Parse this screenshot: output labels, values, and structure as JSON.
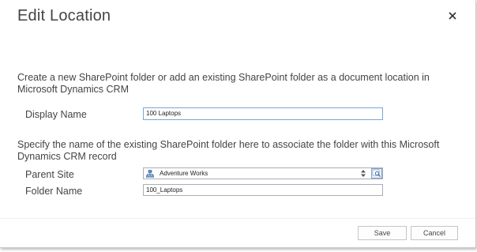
{
  "dialog": {
    "title": "Edit Location"
  },
  "section1": {
    "description": "Create a new SharePoint folder or add an existing SharePoint folder as a document location in Microsoft Dynamics CRM",
    "display_name_label": "Display Name",
    "display_name_value": "100 Laptops"
  },
  "section2": {
    "description": "Specify the name of the existing SharePoint folder here to associate the folder with this Microsoft Dynamics CRM record",
    "parent_site_label": "Parent Site",
    "parent_site_value": "Adventure Works",
    "folder_name_label": "Folder Name",
    "folder_name_value": "100_Laptops"
  },
  "footer": {
    "save_label": "Save",
    "cancel_label": "Cancel"
  },
  "icons": {
    "close": "close-icon",
    "site": "sharepoint-site-icon",
    "spinner": "spinner-arrows-icon",
    "lookup": "lookup-search-icon"
  },
  "colors": {
    "field_border": "#abadb3",
    "active_field_border": "#7aa7d6",
    "title_text": "#444444"
  }
}
